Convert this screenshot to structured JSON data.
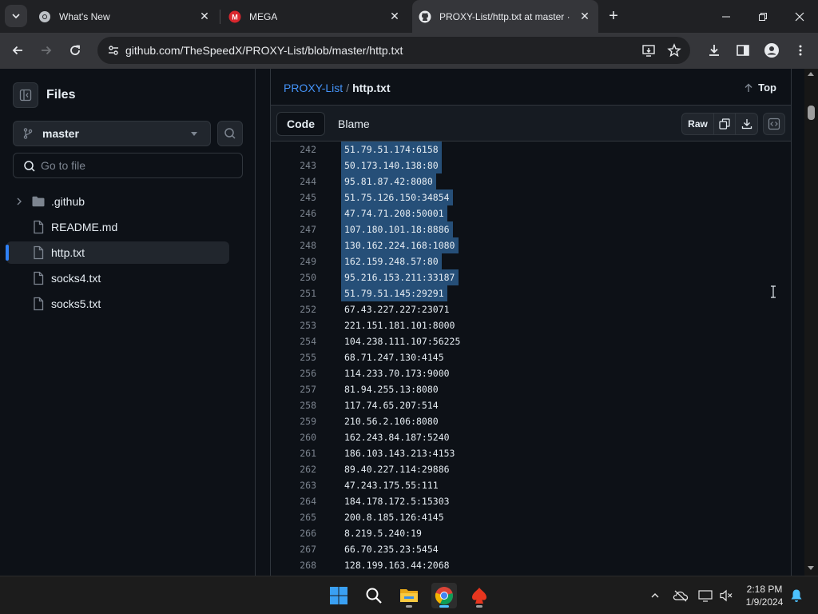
{
  "browser": {
    "tabs": [
      {
        "title": "What's New",
        "favicon": "chrome-icon"
      },
      {
        "title": "MEGA",
        "favicon": "mega-icon"
      },
      {
        "title": "PROXY-List/http.txt at master · ",
        "favicon": "github-icon",
        "active": true
      }
    ],
    "url": "github.com/TheSpeedX/PROXY-List/blob/master/http.txt"
  },
  "sidebar": {
    "title": "Files",
    "branch": "master",
    "goto_placeholder": "Go to file",
    "tree": [
      {
        "label": ".github",
        "type": "folder"
      },
      {
        "label": "README.md",
        "type": "file"
      },
      {
        "label": "http.txt",
        "type": "file",
        "active": true
      },
      {
        "label": "socks4.txt",
        "type": "file"
      },
      {
        "label": "socks5.txt",
        "type": "file"
      }
    ]
  },
  "main": {
    "breadcrumb_repo": "PROXY-List",
    "breadcrumb_sep": "/",
    "breadcrumb_file": "http.txt",
    "top_label": "Top",
    "code_tab": "Code",
    "blame_tab": "Blame",
    "raw_label": "Raw"
  },
  "code_lines": [
    {
      "n": "242",
      "t": "51.79.51.174:6158",
      "sel": true
    },
    {
      "n": "243",
      "t": "50.173.140.138:80",
      "sel": true
    },
    {
      "n": "244",
      "t": "95.81.87.42:8080",
      "sel": true
    },
    {
      "n": "245",
      "t": "51.75.126.150:34854",
      "sel": true
    },
    {
      "n": "246",
      "t": "47.74.71.208:50001",
      "sel": true
    },
    {
      "n": "247",
      "t": "107.180.101.18:8886",
      "sel": true
    },
    {
      "n": "248",
      "t": "130.162.224.168:1080",
      "sel": true
    },
    {
      "n": "249",
      "t": "162.159.248.57:80",
      "sel": true
    },
    {
      "n": "250",
      "t": "95.216.153.211:33187",
      "sel": true
    },
    {
      "n": "251",
      "t": "51.79.51.145:29291",
      "sel": true
    },
    {
      "n": "252",
      "t": "67.43.227.227:23071",
      "sel": false
    },
    {
      "n": "253",
      "t": "221.151.181.101:8000",
      "sel": false
    },
    {
      "n": "254",
      "t": "104.238.111.107:56225",
      "sel": false
    },
    {
      "n": "255",
      "t": "68.71.247.130:4145",
      "sel": false
    },
    {
      "n": "256",
      "t": "114.233.70.173:9000",
      "sel": false
    },
    {
      "n": "257",
      "t": "81.94.255.13:8080",
      "sel": false
    },
    {
      "n": "258",
      "t": "117.74.65.207:514",
      "sel": false
    },
    {
      "n": "259",
      "t": "210.56.2.106:8080",
      "sel": false
    },
    {
      "n": "260",
      "t": "162.243.84.187:5240",
      "sel": false
    },
    {
      "n": "261",
      "t": "186.103.143.213:4153",
      "sel": false
    },
    {
      "n": "262",
      "t": "89.40.227.114:29886",
      "sel": false
    },
    {
      "n": "263",
      "t": "47.243.175.55:111",
      "sel": false
    },
    {
      "n": "264",
      "t": "184.178.172.5:15303",
      "sel": false
    },
    {
      "n": "265",
      "t": "200.8.185.126:4145",
      "sel": false
    },
    {
      "n": "266",
      "t": "8.219.5.240:19",
      "sel": false
    },
    {
      "n": "267",
      "t": "66.70.235.23:5454",
      "sel": false
    },
    {
      "n": "268",
      "t": "128.199.163.44:2068",
      "sel": false
    }
  ],
  "taskbar": {
    "time": "2:18 PM",
    "date": "1/9/2024"
  },
  "colors": {
    "accent": "#2f81f7",
    "selection": "#264f78",
    "link": "#4493f8"
  }
}
